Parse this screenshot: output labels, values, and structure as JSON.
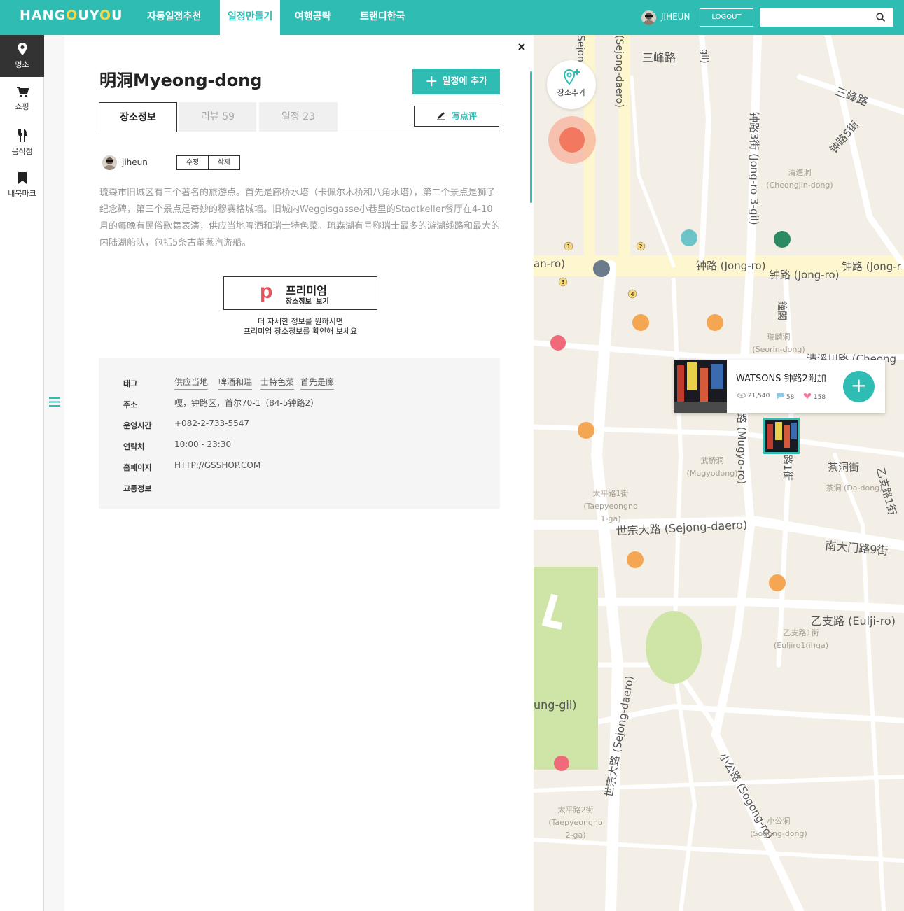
{
  "header": {
    "logo": "HANGOUYOU",
    "nav": [
      "자동일정추천",
      "일정만들기",
      "여행공략",
      "트랜디한국"
    ],
    "active_nav": "일정만들기",
    "username": "JIHEUN",
    "logout_label": "LOGOUT",
    "search_placeholder": ""
  },
  "sidebar": {
    "items": [
      {
        "label": "명소",
        "icon": "pin-icon",
        "active": true
      },
      {
        "label": "쇼핑",
        "icon": "cart-icon",
        "active": false
      },
      {
        "label": "음식점",
        "icon": "fork-knife-icon",
        "active": false
      },
      {
        "label": "내북마크",
        "icon": "bookmark-icon",
        "active": false
      }
    ]
  },
  "place": {
    "title": "明洞Myeong-dong",
    "add_schedule_label": "일정에 추가",
    "tabs": [
      {
        "label": "장소정보",
        "count": ""
      },
      {
        "label": "리뷰",
        "count": "59"
      },
      {
        "label": "일정",
        "count": "23"
      }
    ],
    "write_review_label": "写点评",
    "author": "jiheun",
    "edit_label": "수정",
    "delete_label": "삭제",
    "description": "琉森市旧城区有三个著名的旅游点。首先是廊桥水塔（卡佩尔木桥和八角水塔），第二个景点是狮子纪念碑，第三个景点是奇妙的穆赛格城墙。旧城内Weggisgasse小巷里的Stadtkeller餐厅在4-10月的每晚有民俗歌舞表演，供应当地啤酒和瑞士特色菜。琉森湖有号称瑞士最多的游湖线路和最大的内陆湖船队，包括5条古董蒸汽游船。",
    "premium": {
      "badge": "p",
      "title": "프리미엄",
      "subtitle": "장소정보  보기",
      "note_line1": "더 자세한 정보를 원하시면",
      "note_line2": "프리미엄 장소정보를 확인해 보세요"
    },
    "info": {
      "tag_label": "태그",
      "tags": [
        "供应当地",
        "啤酒和瑞",
        "士特色菜",
        "首先是廊"
      ],
      "address_label": "주소",
      "address": "嘎，钟路区，首尔70-1（84-5钟路2）",
      "hours_label": "운영시간",
      "hours": "+082-2-733-5547",
      "contact_label": "연락처",
      "contact": "10:00 - 23:30",
      "homepage_label": "홈페이지",
      "homepage": "HTTP://GSSHOP.COM",
      "transport_label": "교통정보",
      "transport": ""
    }
  },
  "map": {
    "place_add_label": "장소추가",
    "popup": {
      "title": "WATSONS 钟路2附加",
      "views": "21,540",
      "comments": "58",
      "likes": "158"
    },
    "labels": {
      "sejong_top": "(Sejong-daero)",
      "sejong_left": "Sejong",
      "sambong1": "三峰路",
      "sambong2": "三峰路",
      "jongno5": "钟路5街",
      "jongno3": "钟路3街 (Jong-ro 3-gil)",
      "cheongjin": "清進洞",
      "cheongjin_en": "(Cheongjin-dong)",
      "jongro1": "钟路 (Jong-ro)",
      "jongro2": "钟路 (Jong-ro)",
      "jongro3": "钟路 (Jong-r",
      "anro": "an-ro)",
      "mugyo": "路 (Mugyo-ro)",
      "seorin": "瑞麟洞",
      "seorin_en": "(Seorin-dong)",
      "cheonggye": "清溪川路 (Cheong",
      "mugyodong": "武桥洞",
      "mugyodong_en": "(Mugyodong)",
      "dadong": "茶洞街",
      "dadong2": "茶洞 (Da-dong)",
      "euljiro_v": "乙支路1街",
      "taepyeong": "太平路1街",
      "taepyeong_en": "(Taepyeongno",
      "taepyeong_en2": "1-ga)",
      "sejongdaero": "世宗大路 (Sejong-daero)",
      "namdaemun": "南大门路9街",
      "euljiro": "乙支路 (Eulji-ro)",
      "euljiro1": "乙支路1街",
      "euljiro1_en": "(Euljiro1(il)ga)",
      "sejong_v": "世宗大路 (Sejong-daero)",
      "sogong": "小公路 (Sogong-ro)",
      "sogongdong": "小公洞",
      "sogongdong_en": "(Sogong-dong)",
      "taepyeong2": "太平路2街",
      "taepyeong2_en": "(Taepyeongno",
      "taepyeong2_en2": "2-ga)",
      "nggil": "ung-gil)",
      "jonggak": "鐘閣",
      "seorin_top": "路1街",
      "gil": "gil)"
    }
  },
  "colors": {
    "accent": "#2fbcb3",
    "premium": "#e8525a",
    "map_bg": "#f4efe6",
    "road_main": "#fdf6cf"
  }
}
